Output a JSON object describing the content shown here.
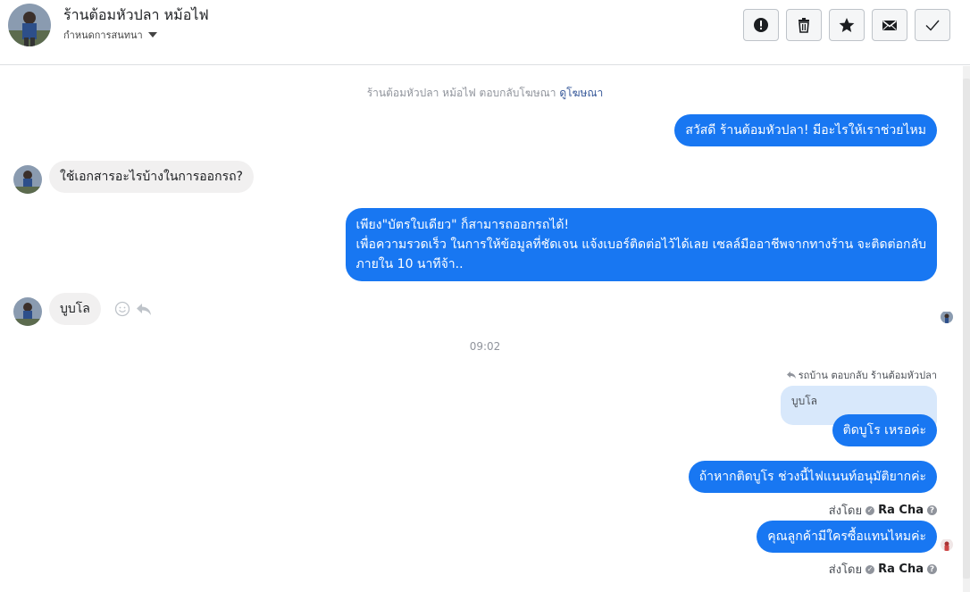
{
  "header": {
    "title": "ร้านต้อมหัวปลา หม้อไฟ",
    "subtitle": "กำหนดการสนทนา",
    "toolbar": [
      {
        "name": "report-button",
        "icon": "exclamation-icon"
      },
      {
        "name": "delete-button",
        "icon": "trash-icon"
      },
      {
        "name": "star-button",
        "icon": "star-icon"
      },
      {
        "name": "mark-unread-button",
        "icon": "envelope-icon"
      },
      {
        "name": "done-button",
        "icon": "check-icon"
      }
    ]
  },
  "conversation": {
    "ad_reply_note": "ร้านต้อมหัวปลา หม้อไฟ ตอบกลับโฆษณา",
    "ad_link": "ดูโฆษณา",
    "messages": {
      "m1": "สวัสดี ร้านต้อมหัวปลา! มีอะไรให้เราช่วยไหม",
      "m2": "ใช้เอกสารอะไรบ้างในการออกรถ?",
      "m3_line1": "เพียง\"บัตรใบเดียว\" ก็สามารถออกรถได้!",
      "m3_line2": "เพื่อความรวดเร็ว ในการให้ข้อมูลที่ชัดเจน แจ้งเบอร์ติดต่อไว้ได้เลย เซลล์มืออาชีพจากทางร้าน จะติดต่อกลับ",
      "m3_line3": "ภายใน 10 นาทีจ้า..",
      "m4": "บูบโล",
      "timestamp": "09:02",
      "reply_meta": "รถบ้าน ตอบกลับ ร้านต้อมหัวปลา",
      "quoted": "บูบโล",
      "m5": "ติดบูโร เหรอค่ะ",
      "m6": "ถ้าหากติดบูโร ช่วงนี้ไฟแนนท์อนุมัติยากค่ะ",
      "m7": "คุณลูกค้ามีใครซื้อแทนไหมค่ะ"
    },
    "sent_by_label": "ส่งโดย",
    "sent_by_name": "Ra Cha"
  },
  "colors": {
    "outgoing": "#1877f2",
    "incoming": "#f1f0f0",
    "quote": "#d8e8fb",
    "link": "#365899"
  }
}
